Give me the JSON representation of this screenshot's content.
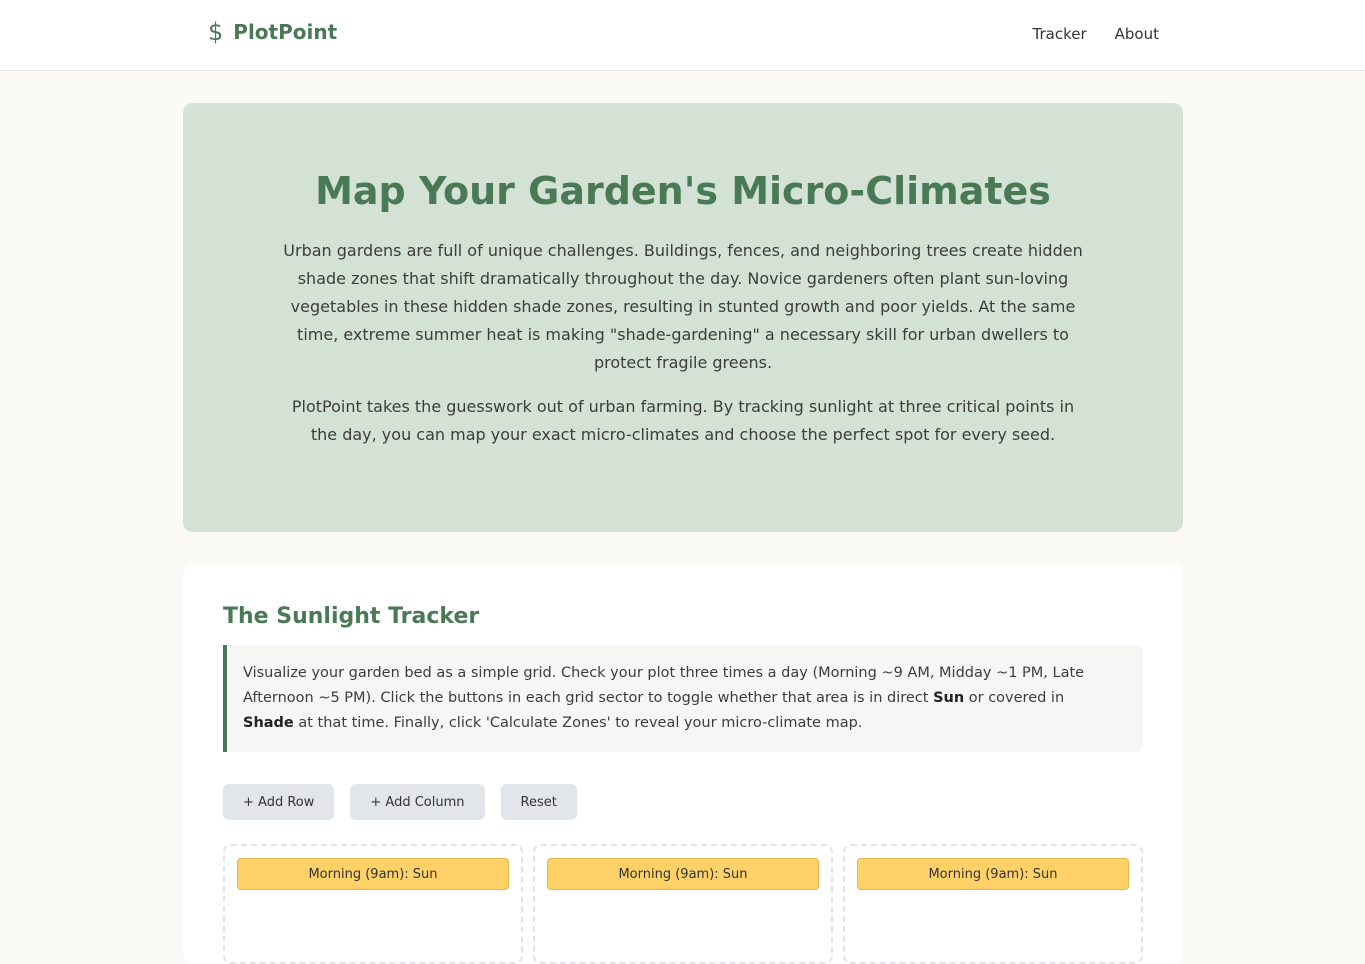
{
  "nav": {
    "brand_icon": "$",
    "brand_name": "PlotPoint",
    "links": [
      "Tracker",
      "About"
    ]
  },
  "hero": {
    "title": "Map Your Garden's Micro-Climates",
    "paragraph1": "Urban gardens are full of unique challenges. Buildings, fences, and neighboring trees create hidden shade zones that shift dramatically throughout the day. Novice gardeners often plant sun-loving vegetables in these hidden shade zones, resulting in stunted growth and poor yields. At the same time, extreme summer heat is making \"shade-gardening\" a necessary skill for urban dwellers to protect fragile greens.",
    "paragraph2": "PlotPoint takes the guesswork out of urban farming. By tracking sunlight at three critical points in the day, you can map your exact micro-climates and choose the perfect spot for every seed."
  },
  "tracker": {
    "title": "The Sunlight Tracker",
    "instructions_part1": "Visualize your garden bed as a simple grid. Check your plot three times a day (Morning ~9 AM, Midday ~1 PM, Late Afternoon ~5 PM). Click the buttons in each grid sector to toggle whether that area is in direct ",
    "instructions_sun": "Sun",
    "instructions_part2": " or covered in ",
    "instructions_shade": "Shade",
    "instructions_part3": " at that time. Finally, click 'Calculate Zones' to reveal your micro-climate map.",
    "buttons": {
      "add_row": "+ Add Row",
      "add_column": "+ Add Column",
      "reset": "Reset"
    },
    "cells": [
      {
        "morning": "Morning (9am): Sun"
      },
      {
        "morning": "Morning (9am): Sun"
      },
      {
        "morning": "Morning (9am): Sun"
      }
    ],
    "colors": {
      "sun": "#ffd166",
      "accent": "#4a7a55"
    }
  }
}
